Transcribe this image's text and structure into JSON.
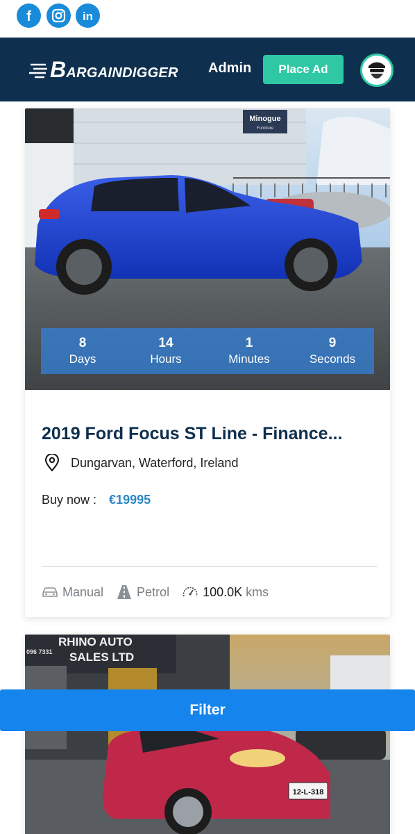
{
  "social": {
    "facebook_label": "f",
    "instagram_label": "ig",
    "linkedin_label": "in"
  },
  "header": {
    "logo_initial": "B",
    "logo_rest": "ARGAINDIGGER",
    "admin_label": "Admin",
    "place_ad_label": "Place Ad",
    "accent_color": "#2ec9a4",
    "background_color": "#0f2f4e"
  },
  "listings": [
    {
      "photo_sign": "Minogue",
      "photo_sign_sub": "Furniture",
      "countdown": [
        {
          "value": "8",
          "label": "Days"
        },
        {
          "value": "14",
          "label": "Hours"
        },
        {
          "value": "1",
          "label": "Minutes"
        },
        {
          "value": "9",
          "label": "Seconds"
        }
      ],
      "title": "2019 Ford Focus ST Line - Finance...",
      "location": "Dungarvan, Waterford, Ireland",
      "price_label": "Buy now :",
      "price": "€19995",
      "transmission": "Manual",
      "fuel": "Petrol",
      "mileage": "100.0K",
      "mileage_unit": "kms"
    },
    {
      "photo_sign_line1": "RHINO AUTO",
      "photo_sign_line2": "SALES LTD",
      "photo_phone": "096 7331",
      "photo_plate": "12-L-318"
    }
  ],
  "filter_label": "Filter"
}
